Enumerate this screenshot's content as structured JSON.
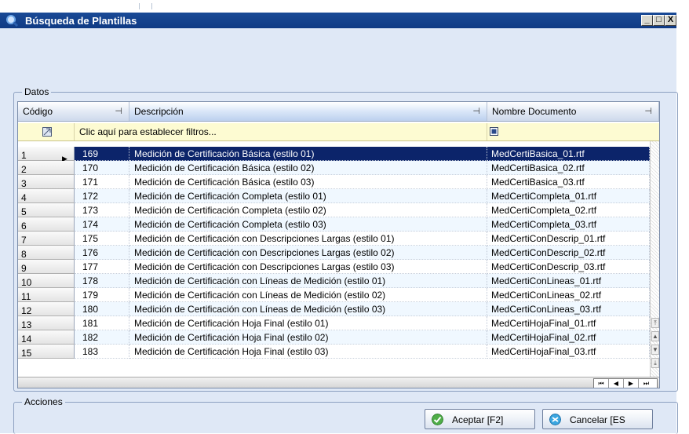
{
  "window": {
    "title": "Búsqueda de Plantillas",
    "controls": [
      "_",
      "□",
      "X"
    ]
  },
  "datos": {
    "legend": "Datos",
    "columns": [
      {
        "label": "Código",
        "pin": "⊣"
      },
      {
        "label": "Descripción",
        "pin": "⊣"
      },
      {
        "label": "Nombre Documento",
        "pin": "⊣"
      }
    ],
    "filter_text": "Clic aquí para establecer filtros...",
    "selected_row": 1,
    "rows": [
      {
        "n": "1",
        "code": "169",
        "desc": "Medición de Certificación Básica (estilo 01)",
        "doc": "MedCertiBasica_01.rtf"
      },
      {
        "n": "2",
        "code": "170",
        "desc": "Medición de Certificación Básica (estilo 02)",
        "doc": "MedCertiBasica_02.rtf"
      },
      {
        "n": "3",
        "code": "171",
        "desc": "Medición de Certificación Básica (estilo 03)",
        "doc": "MedCertiBasica_03.rtf"
      },
      {
        "n": "4",
        "code": "172",
        "desc": "Medición de Certificación Completa (estilo 01)",
        "doc": "MedCertiCompleta_01.rtf"
      },
      {
        "n": "5",
        "code": "173",
        "desc": "Medición de Certificación Completa (estilo 02)",
        "doc": "MedCertiCompleta_02.rtf"
      },
      {
        "n": "6",
        "code": "174",
        "desc": "Medición de Certificación Completa (estilo 03)",
        "doc": "MedCertiCompleta_03.rtf"
      },
      {
        "n": "7",
        "code": "175",
        "desc": "Medición de Certificación con Descripciones Largas (estilo 01)",
        "doc": "MedCertiConDescrip_01.rtf"
      },
      {
        "n": "8",
        "code": "176",
        "desc": "Medición de Certificación con Descripciones Largas (estilo 02)",
        "doc": "MedCertiConDescrip_02.rtf"
      },
      {
        "n": "9",
        "code": "177",
        "desc": "Medición de Certificación con Descripciones Largas (estilo 03)",
        "doc": "MedCertiConDescrip_03.rtf"
      },
      {
        "n": "10",
        "code": "178",
        "desc": "Medición de Certificación con Líneas de Medición (estilo 01)",
        "doc": "MedCertiConLineas_01.rtf"
      },
      {
        "n": "11",
        "code": "179",
        "desc": "Medición de Certificación con Líneas de Medición (estilo 02)",
        "doc": "MedCertiConLineas_02.rtf"
      },
      {
        "n": "12",
        "code": "180",
        "desc": "Medición de Certificación con Líneas de Medición (estilo 03)",
        "doc": "MedCertiConLineas_03.rtf"
      },
      {
        "n": "13",
        "code": "181",
        "desc": "Medición de Certificación Hoja Final (estilo 01)",
        "doc": "MedCertiHojaFinal_01.rtf"
      },
      {
        "n": "14",
        "code": "182",
        "desc": "Medición de Certificación Hoja Final (estilo 02)",
        "doc": "MedCertiHojaFinal_02.rtf"
      },
      {
        "n": "15",
        "code": "183",
        "desc": "Medición de Certificación Hoja Final (estilo 03)",
        "doc": "MedCertiHojaFinal_03.rtf"
      }
    ],
    "nav": [
      "⏮",
      "◀",
      "▶",
      "⏭"
    ]
  },
  "acciones": {
    "legend": "Acciones",
    "accept_label": "Aceptar [F2]",
    "cancel_label": "Cancelar [ES"
  },
  "colors": {
    "titlebar": "#0f3a84",
    "selection": "#0c246a",
    "filter_row": "#fdfbd2"
  }
}
